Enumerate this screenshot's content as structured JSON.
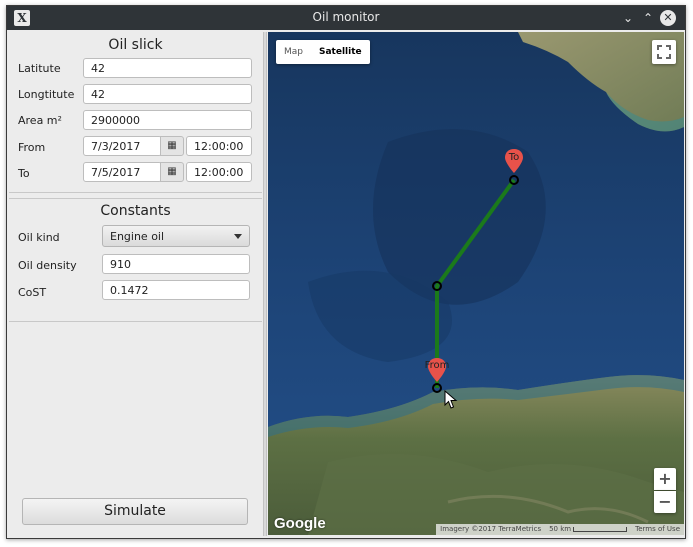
{
  "window": {
    "title": "Oil monitor"
  },
  "oil_slick": {
    "heading": "Oil slick",
    "latitude_label": "Latitute",
    "latitude_value": "42",
    "longitude_label": "Longtitute",
    "longitude_value": "42",
    "area_label": "Area m²",
    "area_value": "2900000",
    "from_label": "From",
    "from_date": "7/3/2017",
    "from_time": "12:00:00",
    "to_label": "To",
    "to_date": "7/5/2017",
    "to_time": "12:00:00"
  },
  "constants": {
    "heading": "Constants",
    "oil_kind_label": "Oil kind",
    "oil_kind_value": "Engine oil",
    "oil_density_label": "Oil density",
    "oil_density_value": "910",
    "cost_label": "CoST",
    "cost_value": "0.1472"
  },
  "simulate_label": "Simulate",
  "map": {
    "type_map": "Map",
    "type_satellite": "Satellite",
    "active_type": "Satellite",
    "zoom_in": "+",
    "zoom_out": "−",
    "logo": "Google",
    "imagery": "Imagery ©2017 TerraMetrics",
    "scale": "50 km",
    "terms": "Terms of Use",
    "marker_to_label": "To",
    "marker_from_label": "From",
    "route_color": "#1b7a1b",
    "marker_color": "#e8524a"
  }
}
